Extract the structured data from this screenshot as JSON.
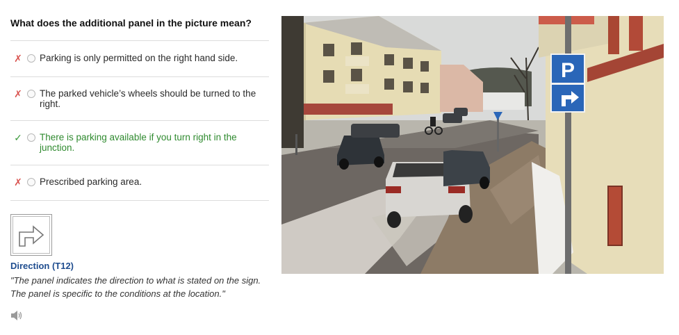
{
  "question": "What does the additional panel in the picture mean?",
  "answers": [
    {
      "mark": "✗",
      "text": "Parking is only permitted on the right hand side.",
      "status": "wrong"
    },
    {
      "mark": "✗",
      "text": "The parked vehicle’s wheels should be turned to the right.",
      "status": "wrong"
    },
    {
      "mark": "✓",
      "text": "There is parking available if you turn right in the junction.",
      "status": "correct"
    },
    {
      "mark": "✗",
      "text": "Prescribed parking area.",
      "status": "wrong"
    }
  ],
  "explanation": {
    "title": "Direction (T12)",
    "text": "\"The panel indicates the direction to what is stated on the sign. The panel is specific to the conditions at the location.\""
  },
  "photo_sign": {
    "letter": "P"
  },
  "colors": {
    "wrong": "#d9534f",
    "correct": "#3c9a3c",
    "link": "#1f4d8f",
    "sign_blue": "#2a66b8"
  },
  "icons": {
    "sign_thumbnail": "turn-right-arrow-icon",
    "speaker": "speaker-icon"
  }
}
